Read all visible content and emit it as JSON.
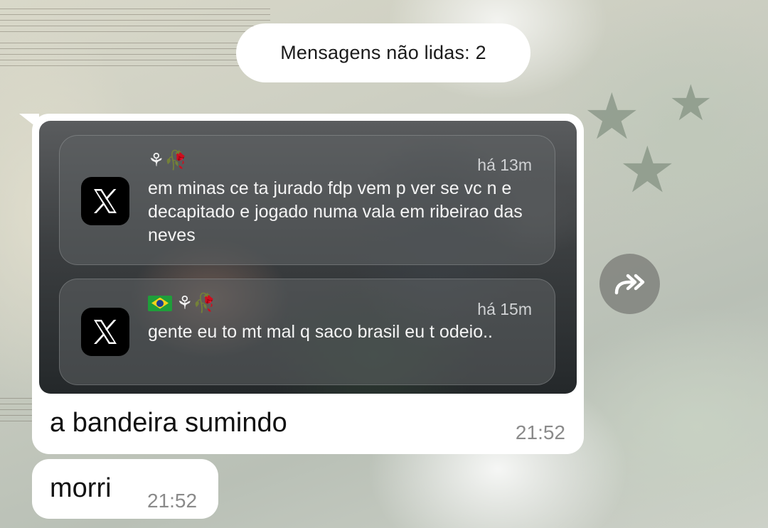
{
  "chat": {
    "unread_label": "Mensagens não lidas: 2",
    "message1": {
      "caption": "a bandeira sumindo",
      "time": "21:52",
      "notifications": [
        {
          "app_icon": "x-twitter-icon",
          "sender_emoji": "⚘🥀",
          "time_ago": "há 13m",
          "text": "em minas ce ta jurado fdp vem p ver se vc n e decapitado e jogado numa vala em ribeirao das neves"
        },
        {
          "app_icon": "x-twitter-icon",
          "sender_emoji": "⚘🥀",
          "sender_flag": "brazil-flag",
          "time_ago": "há 15m",
          "text": "gente eu to mt mal q saco brasil eu t odeio.."
        }
      ]
    },
    "message2": {
      "text": "morri",
      "time": "21:52"
    },
    "forward_button_icon": "forward-icon"
  }
}
